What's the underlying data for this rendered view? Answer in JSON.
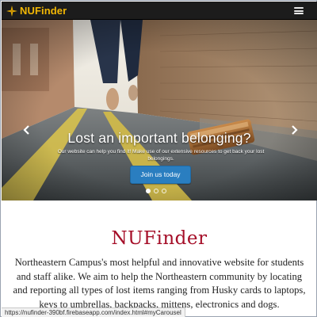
{
  "navbar": {
    "brand": "NUFinder",
    "brand_icon": "compass-star-icon",
    "menu_icon": "hamburger-menu-icon",
    "brand_color": "#f2b705",
    "background": "#1c1c1c"
  },
  "carousel": {
    "title": "Lost an important belonging?",
    "text": "Our website can help you find it! Make use of our extensive resources to get back your lost belongings.",
    "button_label": "Join us today",
    "button_color": "#2a7ec0",
    "prev_icon": "chevron-left-icon",
    "next_icon": "chevron-right-icon",
    "indicators": [
      {
        "active": true
      },
      {
        "active": false
      },
      {
        "active": false
      }
    ]
  },
  "main": {
    "heading": "NUFinder",
    "heading_color": "#a50e28",
    "description": "Northeastern Campus's most helpful and innovative website for students and staff alike. We aim to help the Northeastern community by locating and reporting all types of lost items ranging from Husky cards to laptops, keys to umbrellas, backpacks, mittens, electronics and dogs."
  },
  "status_bar": {
    "url": "https://nufinder-390bf.firebaseapp.com/index.html#myCarousel"
  }
}
